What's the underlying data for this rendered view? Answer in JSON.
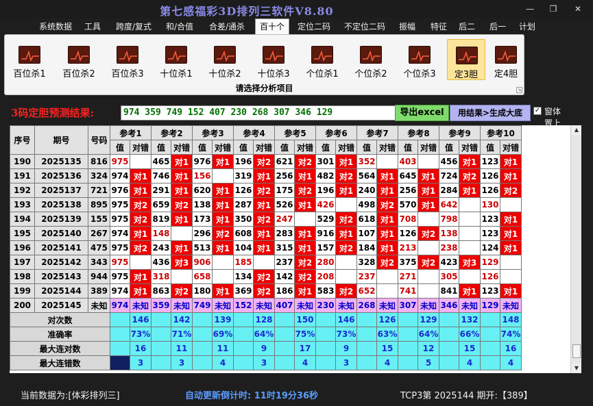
{
  "window": {
    "title": "第七感福彩3D排列三软件V8.80",
    "minimize": "—",
    "maximize": "❐",
    "close": "✕"
  },
  "menu": [
    "系统数据",
    "工具",
    "跨度/复式",
    "和/合值",
    "合差/通杀",
    "百十个",
    "定位二码",
    "不定位二码",
    "振幅",
    "特征",
    "后二",
    "后一",
    "计划"
  ],
  "menu_active": 5,
  "ribbon": {
    "buttons": [
      "百位杀1",
      "百位杀2",
      "百位杀3",
      "十位杀1",
      "十位杀2",
      "十位杀3",
      "个位杀1",
      "个位杀2",
      "个位杀3",
      "定3胆",
      "定4胆"
    ],
    "selected": 9,
    "caption": "请选择分析项目"
  },
  "prediction": {
    "label": "3码定胆预测结果:",
    "value": "974 359 749 152 407 230 268 307 346 129",
    "excel_button": "导出excel",
    "generate_button": "用结果>生成大底",
    "checkbox_label": "窗体置上",
    "checkbox_checked": "✓"
  },
  "table": {
    "headers": {
      "seq": "序号",
      "period": "期号",
      "code": "号码",
      "refs": [
        "参考1",
        "参考2",
        "参考3",
        "参考4",
        "参考5",
        "参考6",
        "参考7",
        "参考8",
        "参考9",
        "参考10"
      ],
      "val": "值",
      "dc": "对错"
    },
    "rows": [
      {
        "seq": "190",
        "period": "2025135",
        "code": "816",
        "cells": [
          [
            "975",
            ""
          ],
          [
            "465",
            "对1"
          ],
          [
            "976",
            "对1"
          ],
          [
            "196",
            "对2"
          ],
          [
            "621",
            "对2"
          ],
          [
            "301",
            "对1"
          ],
          [
            "352",
            ""
          ],
          [
            "403",
            ""
          ],
          [
            "456",
            "对1"
          ],
          [
            "123",
            "对1"
          ]
        ]
      },
      {
        "seq": "191",
        "period": "2025136",
        "code": "324",
        "cells": [
          [
            "974",
            "对1"
          ],
          [
            "746",
            "对1"
          ],
          [
            "156",
            ""
          ],
          [
            "319",
            "对1"
          ],
          [
            "256",
            "对1"
          ],
          [
            "482",
            "对2"
          ],
          [
            "564",
            "对1"
          ],
          [
            "645",
            "对1"
          ],
          [
            "724",
            "对2"
          ],
          [
            "126",
            "对1"
          ]
        ]
      },
      {
        "seq": "192",
        "period": "2025137",
        "code": "721",
        "cells": [
          [
            "976",
            "对1"
          ],
          [
            "291",
            "对1"
          ],
          [
            "620",
            "对1"
          ],
          [
            "126",
            "对2"
          ],
          [
            "175",
            "对2"
          ],
          [
            "196",
            "对1"
          ],
          [
            "240",
            "对1"
          ],
          [
            "256",
            "对1"
          ],
          [
            "284",
            "对1"
          ],
          [
            "126",
            "对2"
          ]
        ]
      },
      {
        "seq": "193",
        "period": "2025138",
        "code": "895",
        "cells": [
          [
            "975",
            "对2"
          ],
          [
            "659",
            "对2"
          ],
          [
            "138",
            "对1"
          ],
          [
            "287",
            "对1"
          ],
          [
            "526",
            "对1"
          ],
          [
            "426",
            ""
          ],
          [
            "498",
            "对2"
          ],
          [
            "570",
            "对1"
          ],
          [
            "642",
            ""
          ],
          [
            "130",
            ""
          ]
        ]
      },
      {
        "seq": "194",
        "period": "2025139",
        "code": "155",
        "cells": [
          [
            "975",
            "对2"
          ],
          [
            "819",
            "对1"
          ],
          [
            "173",
            "对1"
          ],
          [
            "350",
            "对2"
          ],
          [
            "247",
            ""
          ],
          [
            "529",
            "对2"
          ],
          [
            "618",
            "对1"
          ],
          [
            "708",
            ""
          ],
          [
            "798",
            ""
          ],
          [
            "123",
            "对1"
          ]
        ]
      },
      {
        "seq": "195",
        "period": "2025140",
        "code": "267",
        "cells": [
          [
            "974",
            "对1"
          ],
          [
            "148",
            ""
          ],
          [
            "296",
            "对2"
          ],
          [
            "608",
            "对1"
          ],
          [
            "283",
            "对1"
          ],
          [
            "916",
            "对1"
          ],
          [
            "107",
            "对1"
          ],
          [
            "126",
            "对2"
          ],
          [
            "138",
            ""
          ],
          [
            "123",
            "对1"
          ]
        ]
      },
      {
        "seq": "196",
        "period": "2025141",
        "code": "475",
        "cells": [
          [
            "975",
            "对2"
          ],
          [
            "243",
            "对1"
          ],
          [
            "513",
            "对1"
          ],
          [
            "104",
            "对1"
          ],
          [
            "315",
            "对1"
          ],
          [
            "157",
            "对2"
          ],
          [
            "184",
            "对1"
          ],
          [
            "213",
            ""
          ],
          [
            "238",
            ""
          ],
          [
            "124",
            "对1"
          ]
        ]
      },
      {
        "seq": "197",
        "period": "2025142",
        "code": "343",
        "cells": [
          [
            "975",
            ""
          ],
          [
            "436",
            "对3"
          ],
          [
            "906",
            ""
          ],
          [
            "185",
            ""
          ],
          [
            "237",
            "对2"
          ],
          [
            "280",
            ""
          ],
          [
            "328",
            "对2"
          ],
          [
            "375",
            "对2"
          ],
          [
            "423",
            "对3"
          ],
          [
            "129",
            ""
          ]
        ]
      },
      {
        "seq": "198",
        "period": "2025143",
        "code": "944",
        "cells": [
          [
            "975",
            "对1"
          ],
          [
            "318",
            ""
          ],
          [
            "658",
            ""
          ],
          [
            "134",
            "对2"
          ],
          [
            "142",
            "对2"
          ],
          [
            "208",
            ""
          ],
          [
            "237",
            ""
          ],
          [
            "271",
            ""
          ],
          [
            "305",
            ""
          ],
          [
            "126",
            ""
          ]
        ]
      },
      {
        "seq": "199",
        "period": "2025144",
        "code": "389",
        "cells": [
          [
            "974",
            "对1"
          ],
          [
            "863",
            "对2"
          ],
          [
            "180",
            "对1"
          ],
          [
            "369",
            "对2"
          ],
          [
            "186",
            "对1"
          ],
          [
            "583",
            "对2"
          ],
          [
            "652",
            ""
          ],
          [
            "741",
            ""
          ],
          [
            "841",
            "对1"
          ],
          [
            "123",
            "对1"
          ]
        ]
      }
    ],
    "pred_row": {
      "seq": "200",
      "period": "2025145",
      "code": "未知",
      "cells": [
        [
          "974",
          "未知"
        ],
        [
          "359",
          "未知"
        ],
        [
          "749",
          "未知"
        ],
        [
          "152",
          "未知"
        ],
        [
          "407",
          "未知"
        ],
        [
          "230",
          "未知"
        ],
        [
          "268",
          "未知"
        ],
        [
          "307",
          "未知"
        ],
        [
          "346",
          "未知"
        ],
        [
          "129",
          "未知"
        ]
      ]
    },
    "stats": [
      {
        "label": "对次数",
        "values": [
          "146",
          "142",
          "139",
          "128",
          "150",
          "146",
          "126",
          "129",
          "132",
          "148"
        ]
      },
      {
        "label": "准确率",
        "values": [
          "73%",
          "71%",
          "69%",
          "64%",
          "75%",
          "73%",
          "63%",
          "64%",
          "66%",
          "74%"
        ]
      },
      {
        "label": "最大连对数",
        "values": [
          "16",
          "11",
          "11",
          "9",
          "17",
          "9",
          "15",
          "12",
          "15",
          "16"
        ]
      },
      {
        "label": "最大连错数",
        "values": [
          "3",
          "3",
          "4",
          "3",
          "4",
          "3",
          "4",
          "5",
          "4",
          "4"
        ]
      }
    ]
  },
  "status": {
    "source": "当前数据为:[体彩排列三]",
    "countdown": "自动更新倒计时: 11时19分36秒",
    "last": "TCP3第 2025144 期开:【389】"
  }
}
